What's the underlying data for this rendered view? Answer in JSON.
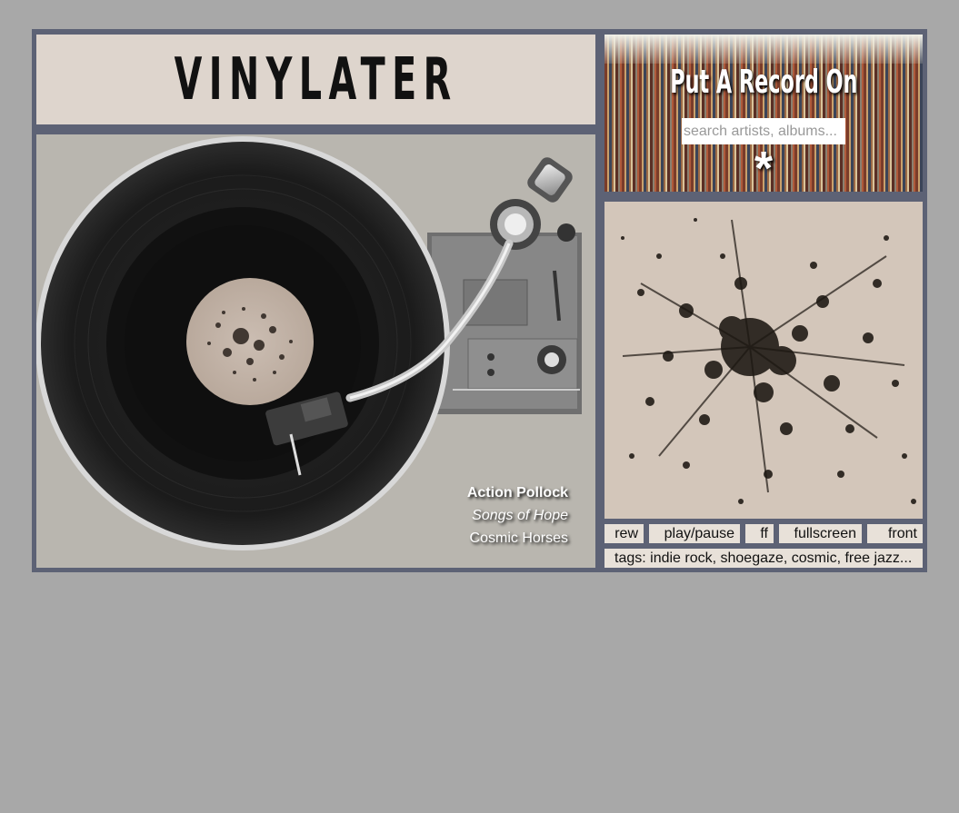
{
  "app": {
    "logo": "VINYLATER"
  },
  "search": {
    "title": "Put A Record On",
    "placeholder": "search artists, albums...",
    "submit_label": "*"
  },
  "now_playing": {
    "artist": "Action Pollock",
    "album": "Songs of Hope",
    "track": "Cosmic Horses"
  },
  "controls": {
    "rew": "rew",
    "play_pause": "play/pause",
    "ff": "ff",
    "fullscreen": "fullscreen",
    "front": "front"
  },
  "tags": {
    "text": "tags: indie rock, shoegaze, cosmic, free jazz..."
  },
  "colors": {
    "background": "#a8a8a8",
    "frame": "#5d6275",
    "panel": "#ded5cd",
    "button": "#e8e1d9"
  },
  "icons": {
    "turntable": "turntable-image",
    "artwork": "ink-splatter-artwork",
    "records": "record-crate-image"
  }
}
